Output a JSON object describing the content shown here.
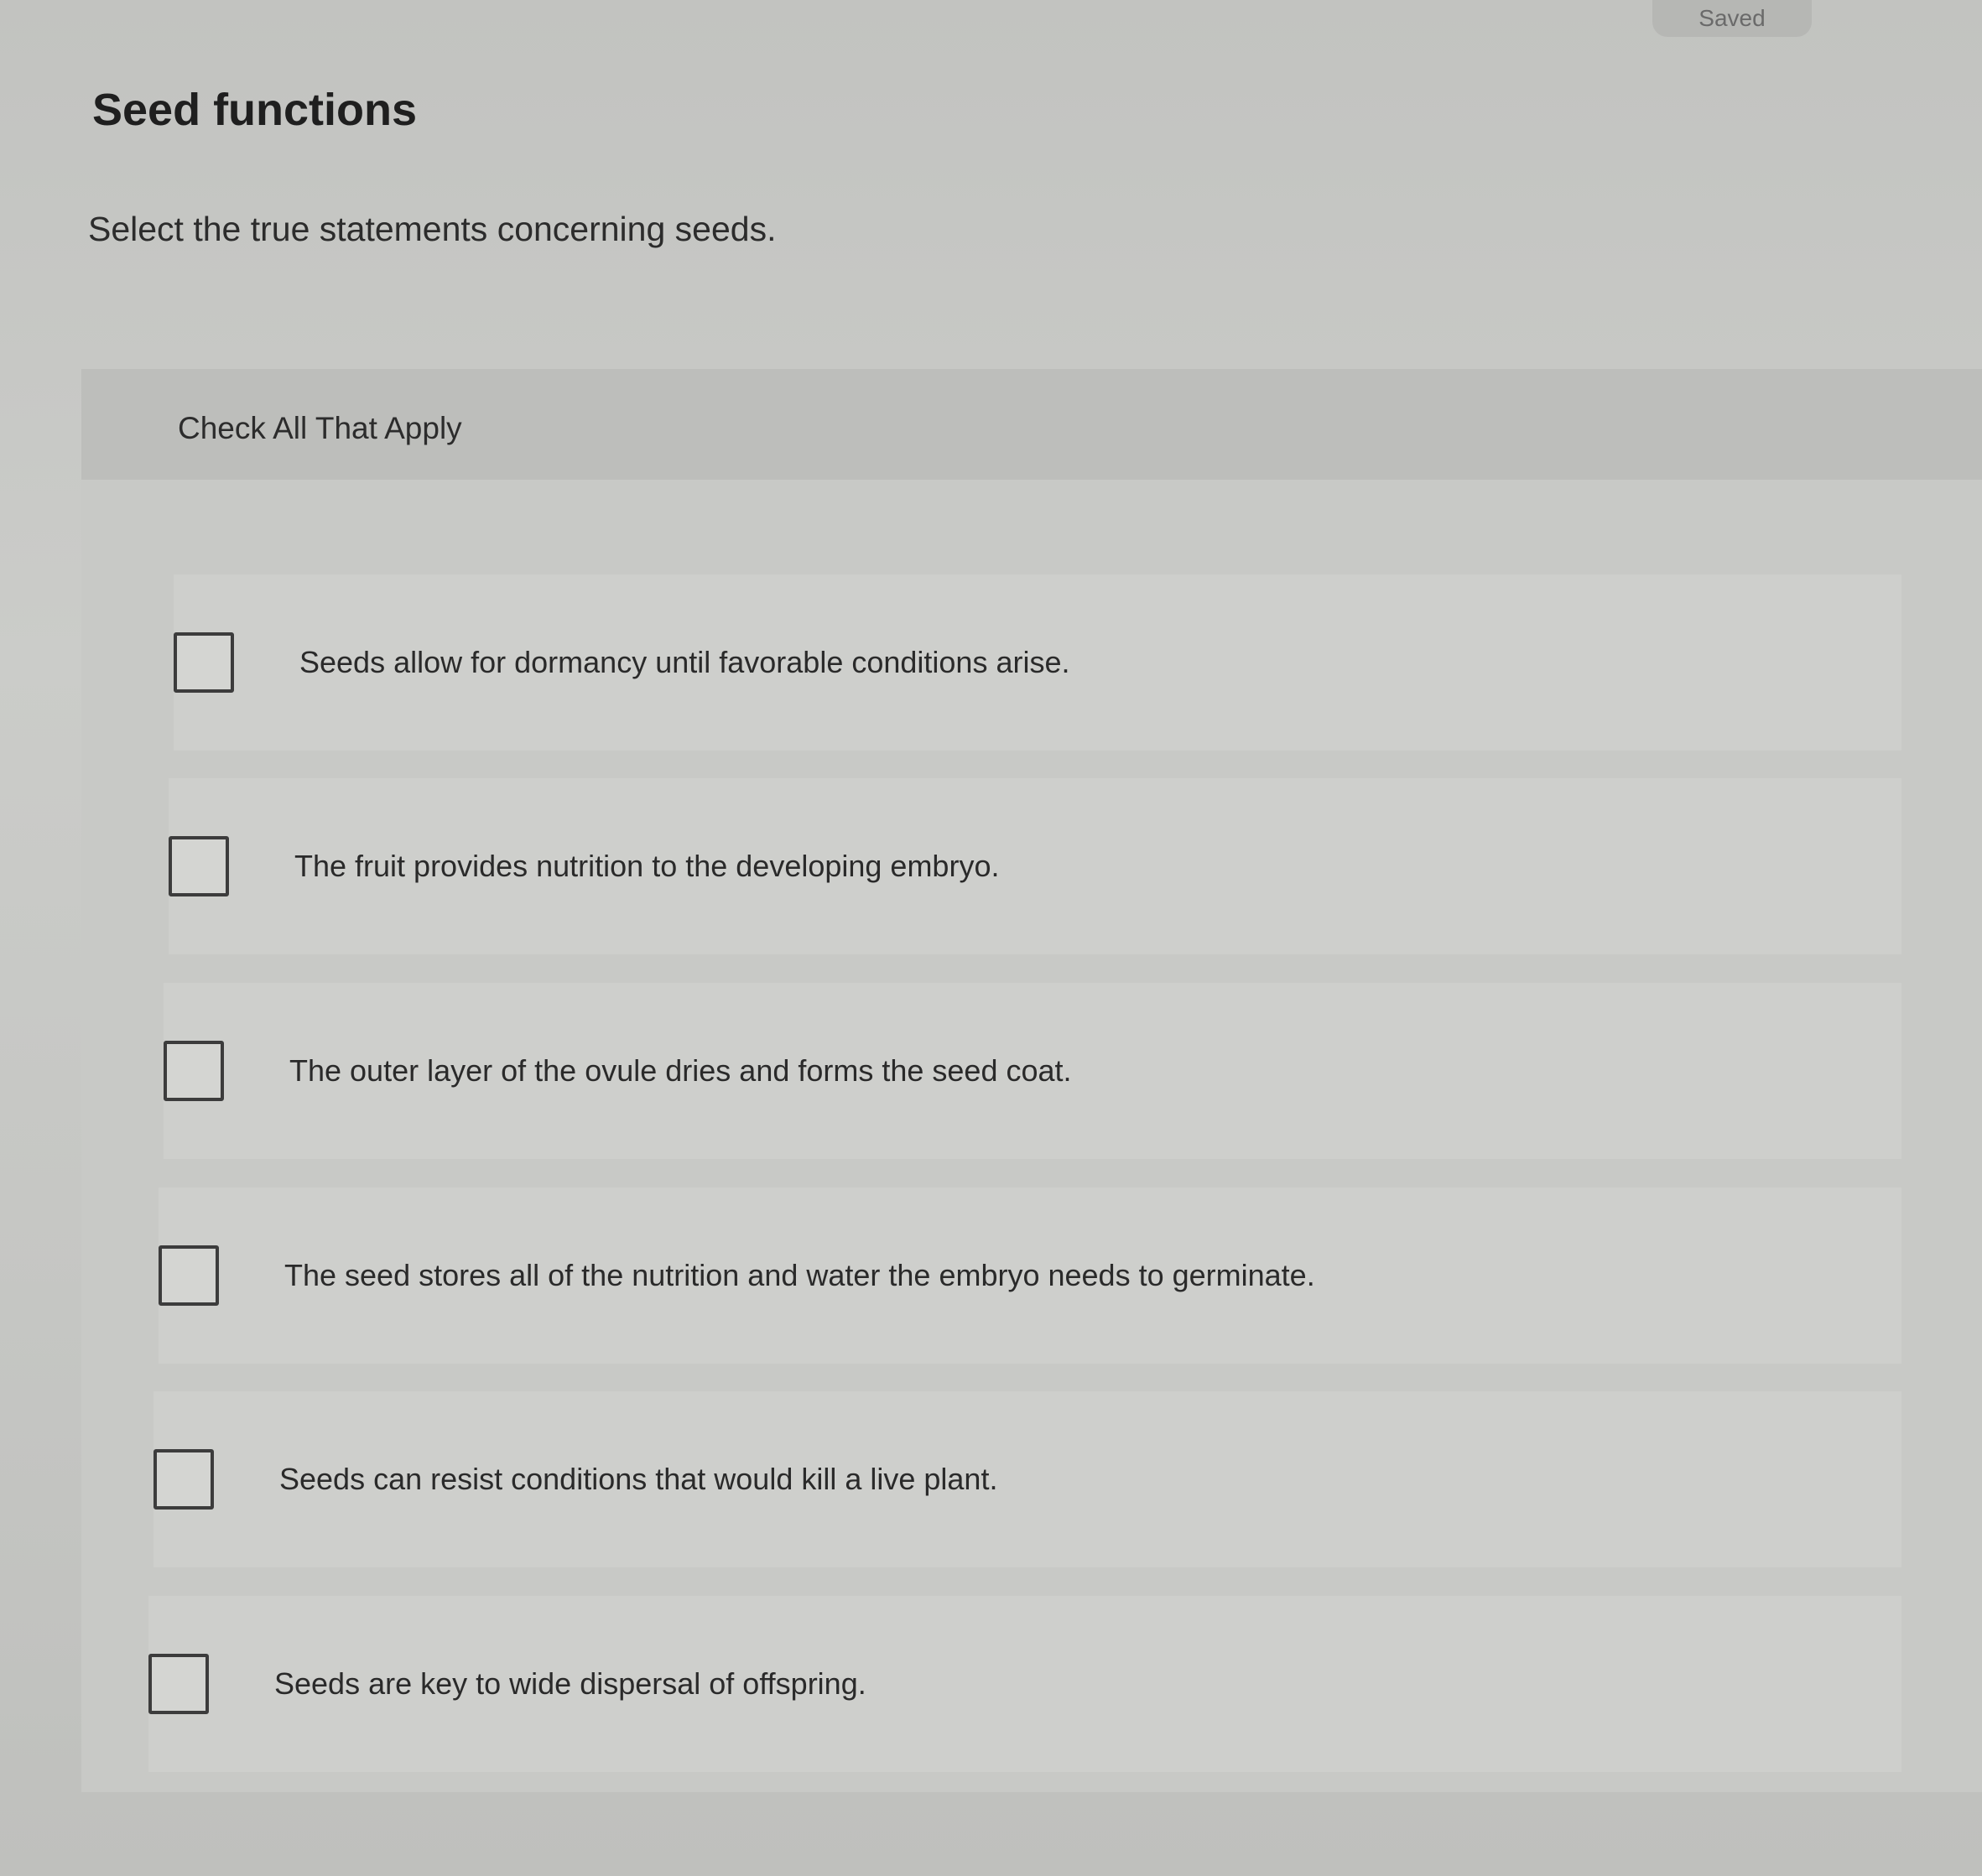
{
  "status": {
    "saved_label": "Saved"
  },
  "question": {
    "title": "Seed functions",
    "prompt": "Select the true statements concerning seeds.",
    "instruction": "Check All That Apply",
    "options": [
      {
        "label": "Seeds allow for dormancy until favorable conditions arise.",
        "checked": false
      },
      {
        "label": "The fruit provides nutrition to the developing embryo.",
        "checked": false
      },
      {
        "label": "The outer layer of the ovule dries and forms the seed coat.",
        "checked": false
      },
      {
        "label": "The seed stores all of the nutrition and water the embryo needs to germinate.",
        "checked": false
      },
      {
        "label": "Seeds can resist conditions that would kill a live plant.",
        "checked": false
      },
      {
        "label": "Seeds are key to wide dispersal of offspring.",
        "checked": false
      }
    ]
  }
}
